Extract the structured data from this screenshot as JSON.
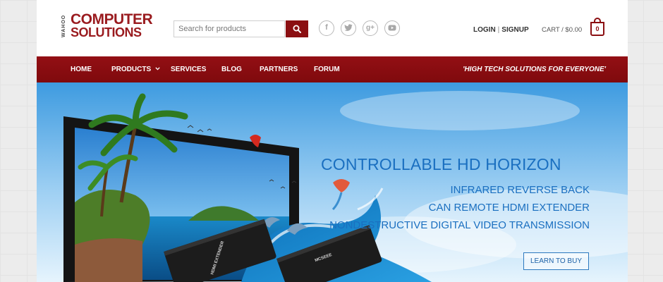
{
  "logo": {
    "brand_small": "WAHOO",
    "line1": "COMPUTER",
    "line2": "SOLUTIONS"
  },
  "search": {
    "placeholder": "Search for products",
    "icon": "search-icon"
  },
  "social": [
    {
      "name": "facebook",
      "icon": "facebook-icon",
      "glyph": "f"
    },
    {
      "name": "twitter",
      "icon": "twitter-icon",
      "glyph": ""
    },
    {
      "name": "google-plus",
      "icon": "google-plus-icon",
      "glyph": "g+"
    },
    {
      "name": "youtube",
      "icon": "youtube-icon",
      "glyph": ""
    }
  ],
  "account": {
    "login": "LOGIN",
    "separator": "|",
    "signup": "SIGNUP"
  },
  "cart": {
    "label": "CART / $0.00",
    "count": "0"
  },
  "nav": {
    "items": [
      "HOME",
      "PRODUCTS",
      "SERVICES",
      "BLOG",
      "PARTNERS",
      "FORUM"
    ],
    "products_chevron": "chevron-down-icon",
    "tagline": "'HIGH TECH SOLUTIONS FOR EVERYONE'"
  },
  "hero": {
    "headline": "CONTROLLABLE HD HORIZON",
    "lines": [
      "INFRARED REVERSE BACK",
      "CAN REMOTE HDMI EXTENDER",
      "NONDESTRUCTIVE DIGITAL VIDEO TRANSMISSION"
    ],
    "cta": "LEARN TO BUY",
    "device_labels": [
      "HDMI EXTENDER",
      "MCSEEE"
    ]
  },
  "colors": {
    "brand_red": "#8b0f12",
    "nav_red": "#930f14",
    "hero_blue": "#1a6fc0",
    "page_bg": "#ececec"
  }
}
